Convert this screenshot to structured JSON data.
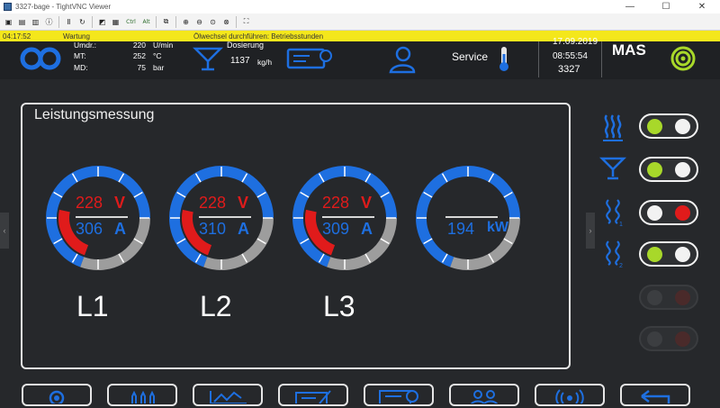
{
  "window": {
    "title": "3327-bage - TightVNC Viewer",
    "minimize": "—",
    "maximize": "☐",
    "close": "✕"
  },
  "toolbar": {
    "ctrl": "Ctrl",
    "alt": "Alt"
  },
  "status": {
    "time": "04:17:52",
    "category": "Wartung",
    "message": "Ölwechsel durchführen: Betriebsstunden"
  },
  "header": {
    "umdr_label": "Umdr.:",
    "umdr_value": "220",
    "umdr_unit": "U/min",
    "mt_label": "MT:",
    "mt_value": "252",
    "mt_unit": "°C",
    "md_label": "MD:",
    "md_value": "75",
    "md_unit": "bar",
    "dosierung_label": "Dosierung",
    "dosierung_value": "1137",
    "dosierung_unit": "kg/h",
    "service_label": "Service",
    "date": "17.09.2019",
    "time": "08:55:54",
    "machine_no": "3327",
    "brand": "MAS"
  },
  "panel": {
    "title": "Leistungsmessung",
    "gauges": [
      {
        "name": "L1",
        "voltage": "228",
        "voltage_unit": "V",
        "current": "306",
        "current_unit": "A"
      },
      {
        "name": "L2",
        "voltage": "228",
        "voltage_unit": "V",
        "current": "310",
        "current_unit": "A"
      },
      {
        "name": "L3",
        "voltage": "228",
        "voltage_unit": "V",
        "current": "309",
        "current_unit": "A"
      },
      {
        "name": "",
        "power": "194",
        "power_unit": "kW"
      }
    ]
  },
  "colors": {
    "blue": "#1e6fe0",
    "red": "#e01b1b",
    "grey": "#9d9d9d",
    "green": "#a8d82a",
    "yellow": "#f4e71b"
  },
  "toggles": [
    {
      "icon": "heat-icon",
      "left": "green",
      "right": "white"
    },
    {
      "icon": "dosing-funnel-icon",
      "left": "green",
      "right": "white"
    },
    {
      "icon": "screw-1-icon",
      "left": "white",
      "right": "red"
    },
    {
      "icon": "screw-2-icon",
      "left": "green",
      "right": "white"
    },
    {
      "icon": "",
      "left": "dim",
      "right": "dimred"
    },
    {
      "icon": "",
      "left": "dim",
      "right": "dimred"
    }
  ],
  "bottom_buttons": [
    "target-icon",
    "bottles-icon",
    "chart-icon",
    "edit-card-icon",
    "gauge-card-icon",
    "users-icon",
    "antenna-icon",
    "back-icon"
  ]
}
